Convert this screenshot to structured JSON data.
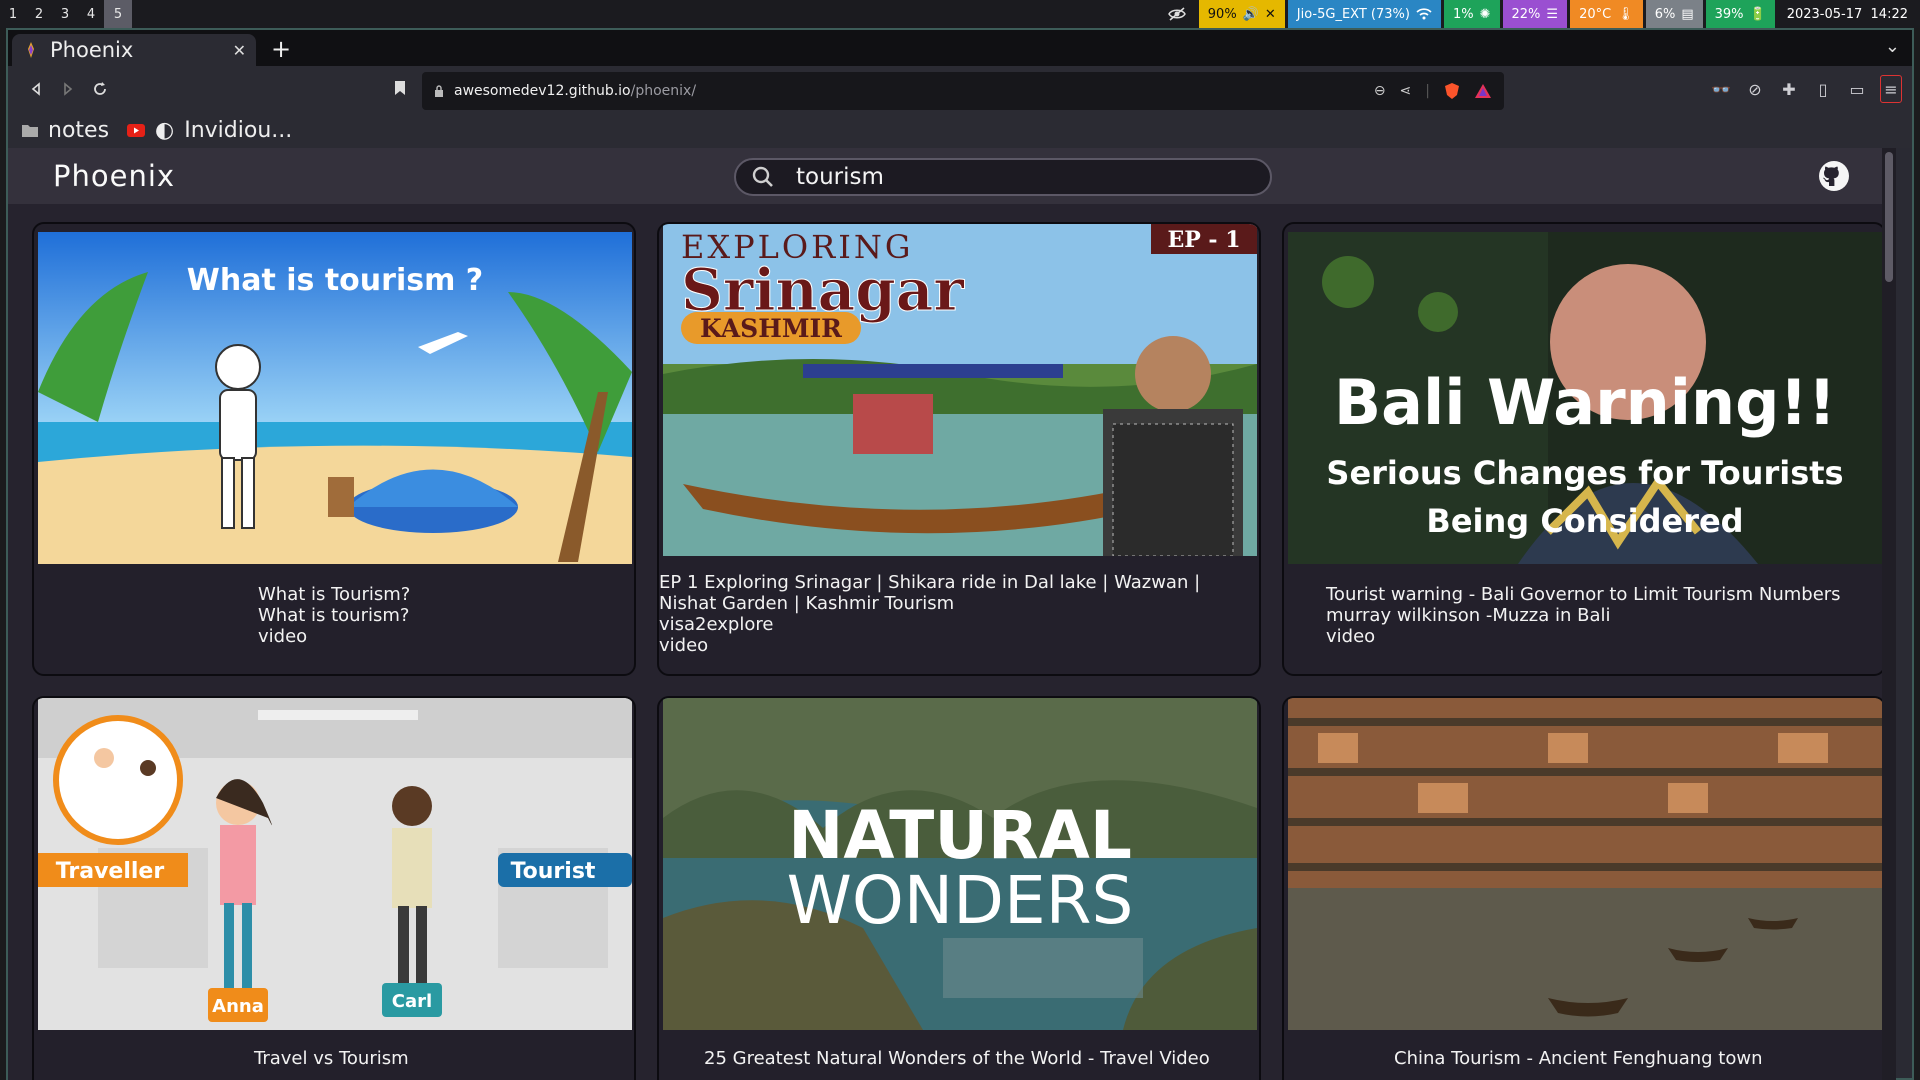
{
  "system_bar": {
    "workspaces": [
      "1",
      "2",
      "3",
      "4",
      "5"
    ],
    "active_workspace": "5",
    "volume": "90%",
    "wifi": "Jio-5G_EXT (73%)",
    "cpu": "1%",
    "memory": "22%",
    "temperature": "20°C",
    "disk": "6%",
    "battery": "39%",
    "datetime": "2023-05-17  14:22",
    "colors": {
      "volume": "#e5b800",
      "wifi": "#2a86c4",
      "cpu": "#1ea35a",
      "memory": "#9a4fd1",
      "temperature": "#f08a24",
      "disk": "#7b8188",
      "battery": "#1ea35a"
    }
  },
  "browser": {
    "tab_title": "Phoenix",
    "url_host": "awesomedev12.github.io",
    "url_path": "/phoenix/",
    "bookmarks": [
      "notes",
      "Invidiou..."
    ]
  },
  "app": {
    "title": "Phoenix",
    "search_value": "tourism"
  },
  "results": [
    {
      "thumb_headline": "What is tourism ?",
      "title": "What is Tourism?",
      "channel": "What is tourism?",
      "type": "video"
    },
    {
      "thumb_headline": "EXPLORING",
      "thumb_headline2": "Srinagar",
      "thumb_tag": "KASHMIR",
      "thumb_badge": "EP - 1",
      "title": "EP 1 Exploring Srinagar | Shikara ride in Dal lake | Wazwan | Nishat Garden | Kashmir Tourism",
      "channel": "visa2explore",
      "type": "video"
    },
    {
      "thumb_headline": "Bali Warning!!",
      "thumb_headline2": "Serious Changes for Tourists",
      "thumb_headline3": "Being Considered",
      "title": "Tourist warning - Bali Governor to Limit Tourism Numbers",
      "channel": "murray wilkinson -Muzza in Bali",
      "type": "video"
    },
    {
      "thumb_labels": [
        "Traveller",
        "Tourist",
        "Anna",
        "Carl"
      ],
      "title": "Travel vs Tourism"
    },
    {
      "thumb_headline": "NATURAL",
      "thumb_headline2": "WONDERS",
      "title": "25 Greatest Natural Wonders of the World - Travel Video"
    },
    {
      "title": "China Tourism - Ancient Fenghuang town"
    }
  ]
}
